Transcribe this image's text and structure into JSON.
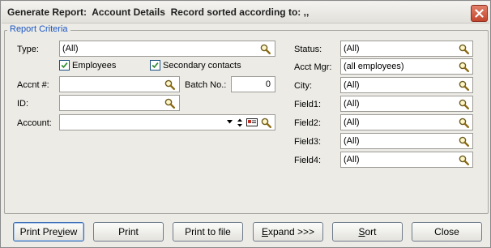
{
  "window": {
    "title": "Generate Report:  Account Details  Record sorted according to: ,,"
  },
  "group": {
    "legend": "Report Criteria"
  },
  "left": {
    "type": {
      "label": "Type:",
      "value": "(All)"
    },
    "employees": {
      "label": "Employees",
      "checked": true
    },
    "secondary": {
      "label": "Secondary contacts",
      "checked": true
    },
    "accnt": {
      "label": "Accnt #:",
      "value": ""
    },
    "batch": {
      "label": "Batch No.:",
      "value": "0"
    },
    "id": {
      "label": "ID:",
      "value": ""
    },
    "account": {
      "label": "Account:",
      "value": ""
    }
  },
  "right": {
    "status": {
      "label": "Status:",
      "value": "(All)"
    },
    "acct_mgr": {
      "label": "Acct Mgr:",
      "value": "(all employees)"
    },
    "city": {
      "label": "City:",
      "value": "(All)"
    },
    "field1": {
      "label": "Field1:",
      "value": "(All)"
    },
    "field2": {
      "label": "Field2:",
      "value": "(All)"
    },
    "field3": {
      "label": "Field3:",
      "value": "(All)"
    },
    "field4": {
      "label": "Field4:",
      "value": "(All)"
    }
  },
  "buttons": {
    "print_preview": {
      "pre": "Print Pre",
      "ul": "v",
      "post": "iew"
    },
    "print": "Print",
    "print_to_file": "Print to file",
    "expand": {
      "ul": "E",
      "post": "xpand >>>"
    },
    "sort": {
      "ul": "S",
      "post": "ort"
    },
    "close": "Close"
  },
  "icons": {
    "search": "magnifier-icon",
    "close": "close-x-icon",
    "dropdown": "dropdown-arrow-icon",
    "sort": "sort-arrows-icon",
    "card": "card-icon",
    "check": "checkmark-icon"
  },
  "colors": {
    "legend": "#1a56c4",
    "close_button": "#c3452c",
    "check": "#2f8a2f"
  }
}
